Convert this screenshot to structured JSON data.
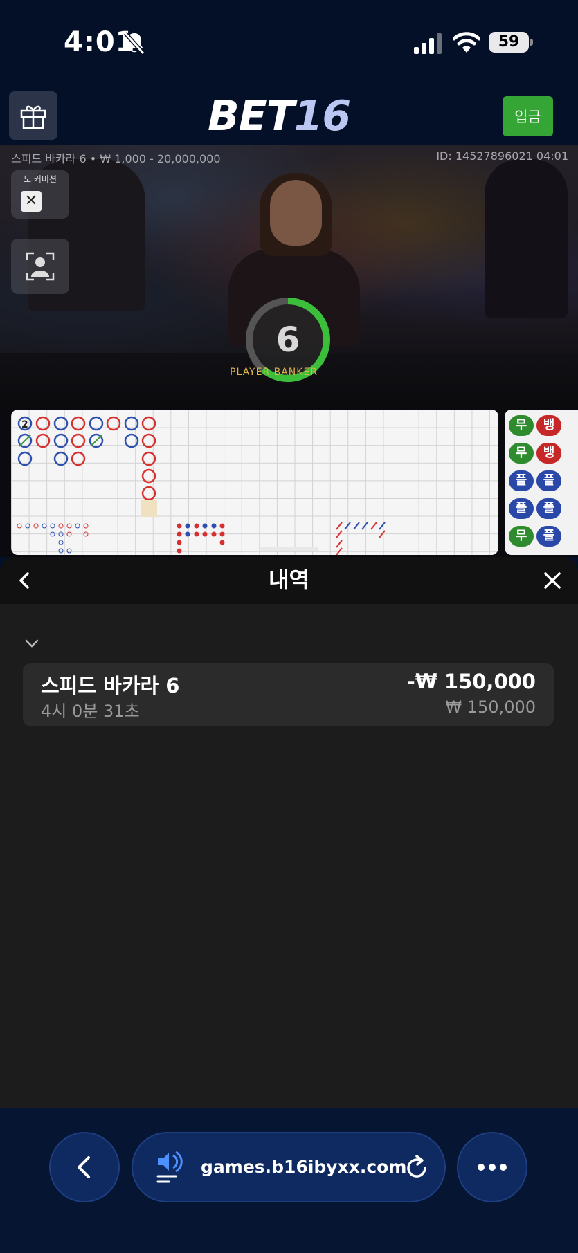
{
  "status_bar": {
    "time": "4:01",
    "battery": "59"
  },
  "header": {
    "logo_part1": "BET",
    "logo_part2": "16",
    "deposit_label": "입금"
  },
  "video": {
    "table_info": "스피드 바카라 6 • ₩ 1,000 - 20,000,000",
    "round_id": "ID: 14527896021 04:01",
    "no_commission_label": "노 커미션",
    "countdown": "6",
    "player_banker_label": "PLAYER  BANKER"
  },
  "big_road_mark": "2",
  "bead_road": [
    "무",
    "뱅",
    "무",
    "뱅",
    "플",
    "플",
    "플",
    "플",
    "무",
    "플"
  ],
  "history": {
    "title": "내역",
    "entries": [
      {
        "game": "스피드 바카라 6",
        "time": "4시 0분 31초",
        "amount": "-₩ 150,000",
        "bet": "₩ 150,000"
      }
    ]
  },
  "browser": {
    "url": "games.b16ibyxx.com"
  },
  "colors": {
    "deposit": "#35a535",
    "background": "#041027",
    "timer_ring": "#3bbf3b"
  }
}
